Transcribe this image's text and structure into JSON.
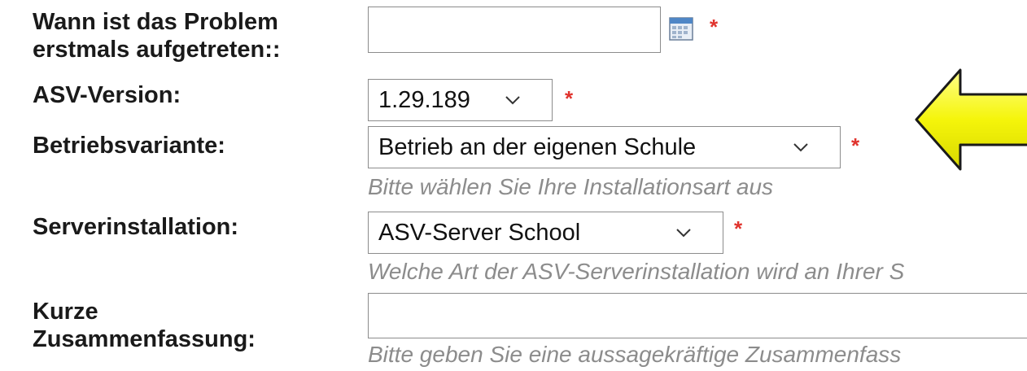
{
  "form": {
    "first_occurrence": {
      "label": "Wann ist das Problem erstmals aufgetreten::",
      "value": "",
      "required_marker": "*",
      "icon": "calendar-icon"
    },
    "asv_version": {
      "label": "ASV-Version:",
      "selected": "1.29.189",
      "required_marker": "*"
    },
    "operating_variant": {
      "label": "Betriebsvariante:",
      "selected": "Betrieb an der eigenen Schule",
      "required_marker": "*",
      "hint": "Bitte wählen Sie Ihre Installationsart aus"
    },
    "server_installation": {
      "label": "Serverinstallation:",
      "selected": "ASV-Server School",
      "required_marker": "*",
      "hint": "Welche Art der ASV-Serverinstallation wird an Ihrer S"
    },
    "summary": {
      "label": "Kurze Zusammenfassung:",
      "value": "",
      "hint": "Bitte geben Sie eine aussagekräftige Zusammenfass"
    }
  },
  "annotation": {
    "arrow_color": "#f5f50a",
    "arrow_outline": "#1a1a1a"
  }
}
